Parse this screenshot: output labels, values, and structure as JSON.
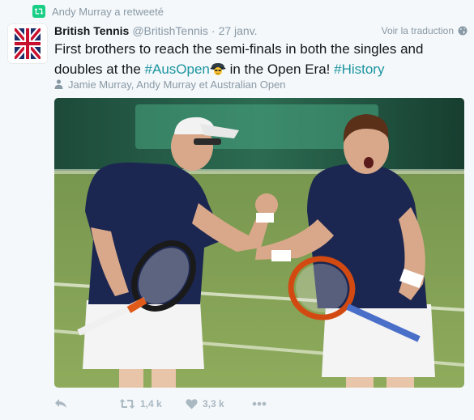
{
  "retweet": {
    "label": "Andy Murray a retweeté",
    "icon": "retweet-icon"
  },
  "author": {
    "name": "British Tennis",
    "handle": "@BritishTennis",
    "separator": "·",
    "date": "27 janv.",
    "avatar_icon": "union-jack-logo"
  },
  "translate": {
    "label": "Voir la traduction",
    "icon": "globe-icon"
  },
  "tweet": {
    "text_part1": "First brothers to reach the semi-finals in both the singles and doubles at the ",
    "hashtag1": "#AusOpen",
    "emoji_icon": "tennis-hat-emoji",
    "text_part2": " in the Open Era! ",
    "hashtag2": "#History"
  },
  "tagged": {
    "icon": "person-icon",
    "label": "Jamie Murray, Andy Murray et Australian Open"
  },
  "media": {
    "icon": "tennis-players-photo"
  },
  "actions": {
    "reply_icon": "reply-icon",
    "retweet_icon": "retweet-icon",
    "retweet_count": "1,4 k",
    "like_icon": "heart-icon",
    "like_count": "3,3 k",
    "more_icon": "more-icon"
  },
  "colors": {
    "muted": "#8899a6",
    "hashtag": "#1b95a0",
    "retweet_green": "#19cf86",
    "action_gray": "#aab8c2"
  }
}
